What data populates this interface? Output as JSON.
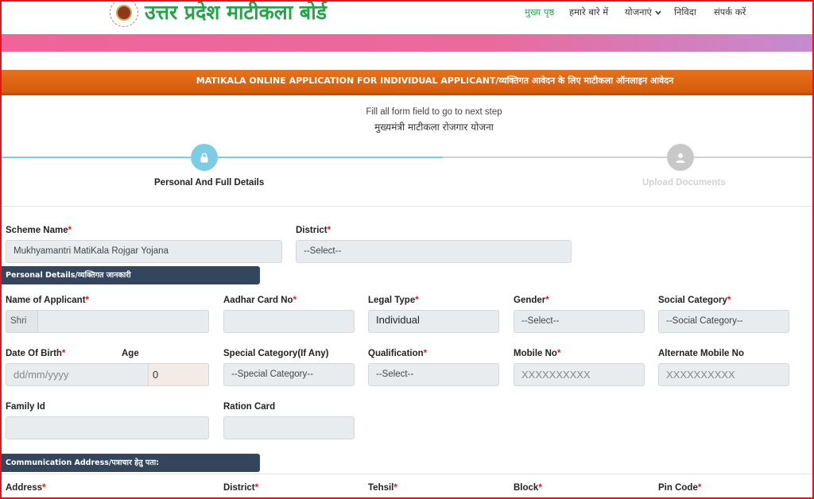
{
  "header": {
    "site_title": "उत्तर प्रदेश माटीकला बोर्ड",
    "nav": [
      "मुख्य पृष्ठ",
      "हमारे बारे में",
      "योजनाएं",
      "निविदा",
      "संपर्क करें"
    ],
    "logo_icon": "board-emblem-icon",
    "dropdown_icon": "chevron-down-icon"
  },
  "form_title": "MATIKALA ONLINE APPLICATION FOR INDIVIDUAL APPLICANT/व्यक्तिगत आवेदन के लिए माटीकला ऑनलाइन आवेदन",
  "stepper": {
    "hint": "Fill all form field to go to next step",
    "scheme_heading": "मुख्यमंत्री माटीकला रोजगार योजना",
    "steps": [
      {
        "label": "Personal And Full Details",
        "icon": "lock-icon"
      },
      {
        "label": "Upload Documents",
        "icon": "user-icon"
      }
    ],
    "active_color": "#7ccde3",
    "inactive_color": "#c8c8c8"
  },
  "scheme": {
    "scheme_name_label": "Scheme Name",
    "scheme_name_value": "Mukhyamantri MatiKala Rojgar Yojana",
    "district_label": "District",
    "district_value": "--Select--"
  },
  "sections": {
    "personal": "Personal Details/व्यक्तिगत जानकारी",
    "communication": "Communication Address/पत्राचार हेतु पता:"
  },
  "personal": {
    "name_label": "Name of Applicant",
    "name_prefix": "Shri",
    "aadhar_label": "Aadhar Card No",
    "legal_type_label": "Legal Type",
    "legal_type_value": "Individual",
    "gender_label": "Gender",
    "gender_value": "--Select--",
    "social_label": "Social Category",
    "social_value": "--Social Category--",
    "dob_label": "Date Of Birth",
    "dob_placeholder": "dd/mm/yyyy",
    "age_label": "Age",
    "age_value": "0",
    "special_label": "Special Category(If Any)",
    "special_value": "--Special Category--",
    "qualification_label": "Qualification",
    "qualification_value": "--Select--",
    "mobile_label": "Mobile No",
    "mobile_placeholder": "XXXXXXXXXX",
    "alt_mobile_label": "Alternate Mobile No",
    "alt_mobile_placeholder": "XXXXXXXXXX",
    "family_label": "Family Id",
    "ration_label": "Ration Card"
  },
  "address": {
    "address_label": "Address",
    "district_label": "District",
    "tehsil_label": "Tehsil",
    "block_label": "Block",
    "pincode_label": "Pin Code"
  },
  "colors": {
    "brand_green": "#25a24a",
    "title_orange": "#e06614",
    "section_navy": "#34465d",
    "required_red": "#e31b1b"
  }
}
